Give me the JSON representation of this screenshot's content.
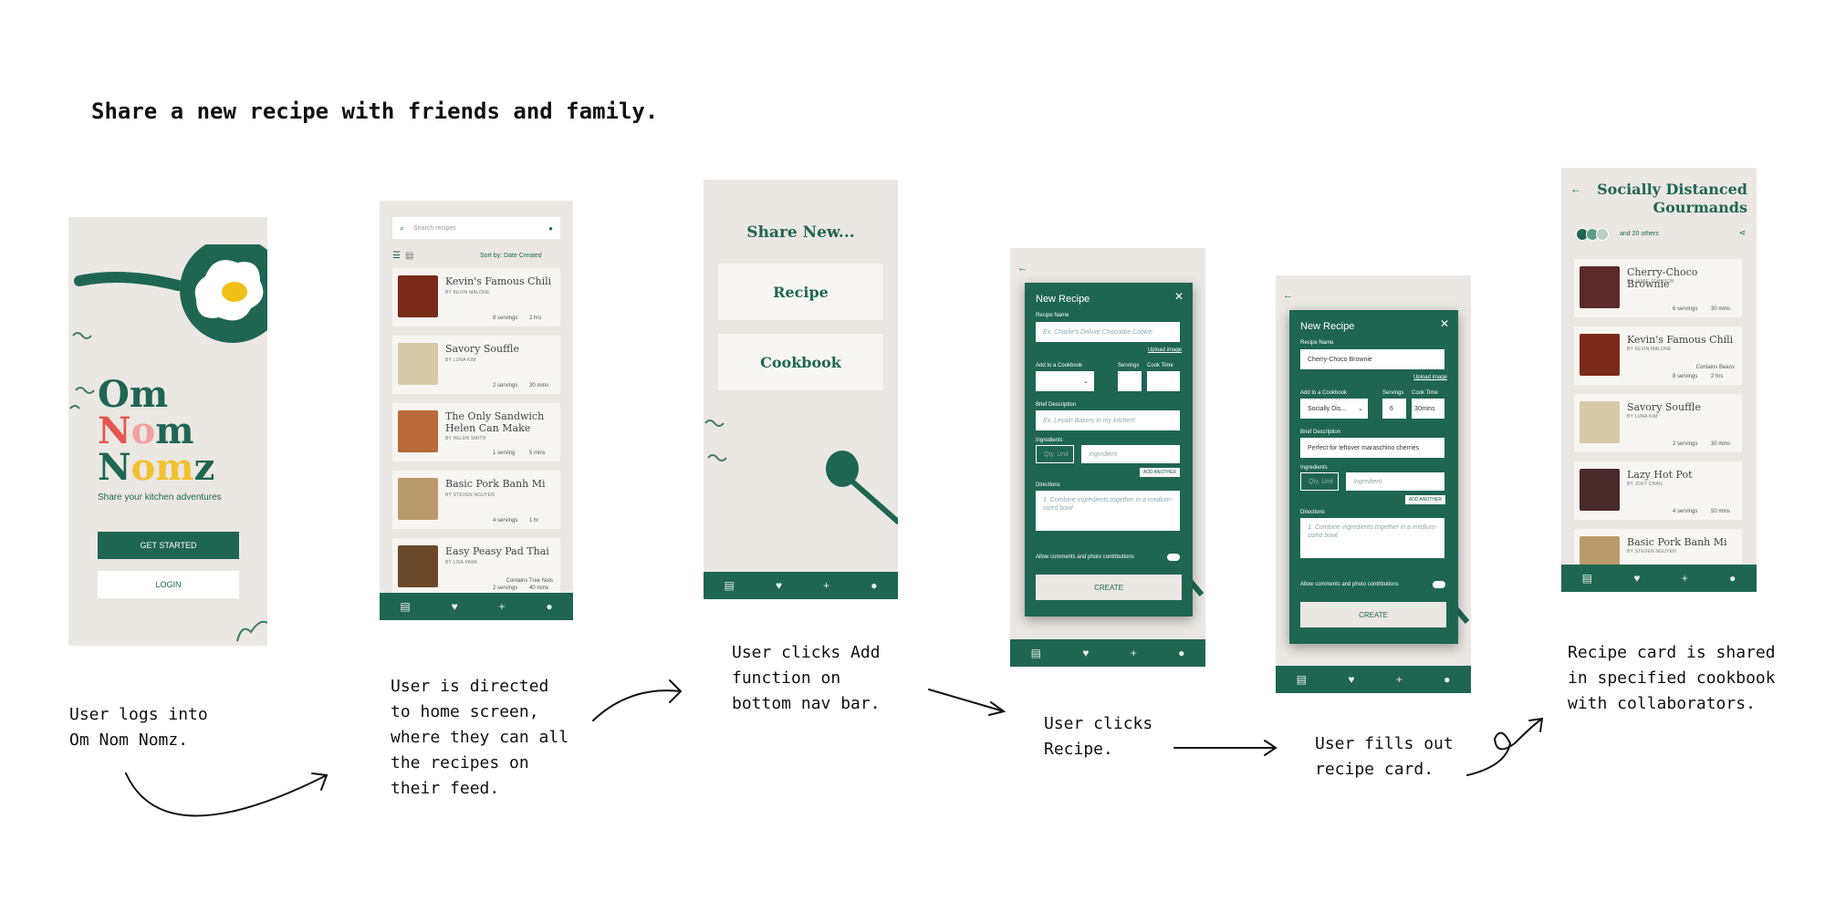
{
  "title": "Share a new recipe with friends and family.",
  "captions": {
    "step1": "User logs into\nOm Nom Nomz.",
    "step2": "User is directed\nto home screen,\nwhere they can all\nthe recipes on\ntheir feed.",
    "step3": "User clicks Add\nfunction on\nbottom nav bar.",
    "step4": "User clicks\nRecipe.",
    "step5": "User fills out\nrecipe card.",
    "step6": "Recipe card is shared\nin specified cookbook\nwith collaborators."
  },
  "login": {
    "logo_line1": "Om",
    "logo_n1": "N",
    "logo_o1": "o",
    "logo_m1": "m",
    "logo_n2": "N",
    "logo_o2": "o",
    "logo_m2": "m",
    "logo_z": "z",
    "tagline": "Share your kitchen adventures",
    "get_started": "GET STARTED",
    "login": "LOGIN",
    "colors": {
      "brand": "#1f6652",
      "coral": "#e5554f",
      "pink": "#f2a0a0",
      "yellow": "#f2c12e"
    }
  },
  "home": {
    "search_placeholder": "Search recipes",
    "sort": "Sort by: Date Created",
    "recipes": [
      {
        "title": "Kevin's Famous Chili",
        "by": "BY KEVIN MALONE",
        "servings": "8 servings",
        "time": "2 hrs"
      },
      {
        "title": "Savory Souffle",
        "by": "BY LUNA KIM",
        "servings": "2 servings",
        "time": "30 mins"
      },
      {
        "title": "The Only Sandwich Helen Can Make",
        "by": "BY HELEN SMITH",
        "servings": "1 serving",
        "time": "5 mins"
      },
      {
        "title": "Basic Pork Banh Mi",
        "by": "BY STEVEN NGUYEN",
        "servings": "4 servings",
        "time": "1 hr"
      },
      {
        "title": "Easy Peasy Pad Thai",
        "by": "BY LISA PARK",
        "note": "Contains Tree Nuts",
        "servings": "2 servings",
        "time": "40 mins"
      }
    ]
  },
  "share": {
    "heading": "Share New...",
    "option1": "Recipe",
    "option2": "Cookbook"
  },
  "new_recipe_empty": {
    "header": "New Recipe",
    "name_label": "Recipe Name",
    "name_placeholder": "Ex. Charlie's Deluxe Chocolate Cookie",
    "upload": "Upload image",
    "cookbook_label": "Add to a Cookbook",
    "servings_label": "Servings",
    "cooktime_label": "Cook Time",
    "desc_label": "Brief Description",
    "desc_placeholder": "Ex. Levain Bakery in my kitchen!",
    "ingredients_label": "Ingredients",
    "qty_placeholder": "Qty, Unit",
    "ingredient_placeholder": "Ingredient",
    "add_another": "ADD ANOTHER",
    "directions_label": "Directions",
    "directions_placeholder": "1. Combine ingredients together in a medium-sized bowl",
    "allow": "Allow comments and photo contributions",
    "create": "CREATE"
  },
  "new_recipe_filled": {
    "header": "New Recipe",
    "name_label": "Recipe Name",
    "name_value": "Cherry-Choco Brownie",
    "upload": "Upload image",
    "cookbook_label": "Add to a Cookbook",
    "cookbook_value": "Socially Dis...",
    "servings_label": "Servings",
    "servings_value": "6",
    "cooktime_label": "Cook Time",
    "cooktime_value": "30mins",
    "desc_label": "Brief Description",
    "desc_value": "Perfect for leftover maraschino cherries",
    "ingredients_label": "Ingredients",
    "qty_placeholder": "Qty, Unit",
    "ingredient_placeholder": "Ingredient",
    "add_another": "ADD ANOTHER",
    "directions_label": "Directions",
    "directions_placeholder": "1. Combine ingredients together in a medium-sized bowl",
    "allow": "Allow comments and photo contributions",
    "create": "CREATE"
  },
  "cookbook": {
    "title": "Socially Distanced Gourmands",
    "others": "and 20 others",
    "recipes": [
      {
        "title": "Cherry-Choco Brownie",
        "by": "BY JAMIE JOHNSON",
        "servings": "6 servings",
        "time": "30 mins"
      },
      {
        "title": "Kevin's Famous Chili",
        "by": "BY KEVIN MALONE",
        "note": "Contains Beans",
        "servings": "8 servings",
        "time": "2 hrs"
      },
      {
        "title": "Savory Souffle",
        "by": "BY LUNA KIM",
        "servings": "2 servings",
        "time": "30 mins"
      },
      {
        "title": "Lazy Hot Pot",
        "by": "BY JOEY CHAN",
        "servings": "4 servings",
        "time": "50 mins"
      },
      {
        "title": "Basic Pork Banh Mi",
        "by": "BY STEVEN NGUYEN"
      }
    ]
  }
}
